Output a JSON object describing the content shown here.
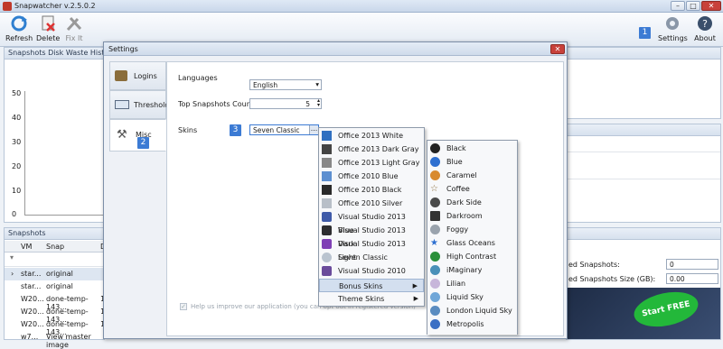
{
  "app": {
    "title": "Snapwatcher v.2.5.0.2"
  },
  "toolbar": {
    "refresh": "Refresh",
    "delete": "Delete",
    "fixit": "Fix It",
    "settings": "Settings",
    "about": "About",
    "badge1": "1"
  },
  "left_panel": {
    "title": "Snapshots Disk Waste History",
    "y_ticks": [
      "50",
      "40",
      "30",
      "20",
      "10",
      "0"
    ]
  },
  "snapshots": {
    "title": "Snapshots",
    "columns": [
      "VM",
      "Snap",
      "D"
    ],
    "rows": [
      {
        "vm": "star...",
        "snap": "original"
      },
      {
        "vm": "star...",
        "snap": "original"
      },
      {
        "vm": "W20...",
        "snap": "done-temp-143...",
        "d": "1"
      },
      {
        "vm": "W20...",
        "snap": "done-temp-143...",
        "d": "1"
      },
      {
        "vm": "W20...",
        "snap": "done-temp-143...",
        "d": "1"
      },
      {
        "vm": "w7...",
        "snap": "View master image",
        "d": ""
      }
    ]
  },
  "right_panel": {
    "label1": "ed Snapshots:",
    "value1": "0",
    "label2": "ed Snapshots Size (GB):",
    "value2": "0.00",
    "ad": "Start FREE"
  },
  "dialog": {
    "title": "Settings",
    "tabs": [
      "Logins",
      "Thresholds",
      "Misc"
    ],
    "badge2": "2",
    "badge3": "3",
    "languages_label": "Languages",
    "languages_value": "English",
    "top_label": "Top Snapshots Count",
    "top_value": "5",
    "skins_label": "Skins",
    "skins_value": "Seven Classic",
    "improve": "Help us improve our application (you can opt out in registered version)"
  },
  "skins_menu": [
    "Office 2013 White",
    "Office 2013 Dark Gray",
    "Office 2013 Light Gray",
    "Office 2010 Blue",
    "Office 2010 Black",
    "Office 2010 Silver",
    "Visual Studio 2013 Blue",
    "Visual Studio 2013 Dark",
    "Visual Studio 2013 Light",
    "Seven Classic",
    "Visual Studio 2010",
    "Bonus Skins",
    "Theme Skins"
  ],
  "bonus_menu": [
    "Black",
    "Blue",
    "Caramel",
    "Coffee",
    "Dark Side",
    "Darkroom",
    "Foggy",
    "Glass Oceans",
    "High Contrast",
    "iMaginary",
    "Lilian",
    "Liquid Sky",
    "London Liquid Sky",
    "Metropolis"
  ],
  "colors": {
    "accent": "#3c7bd4",
    "highlight": "#d3dfef"
  }
}
